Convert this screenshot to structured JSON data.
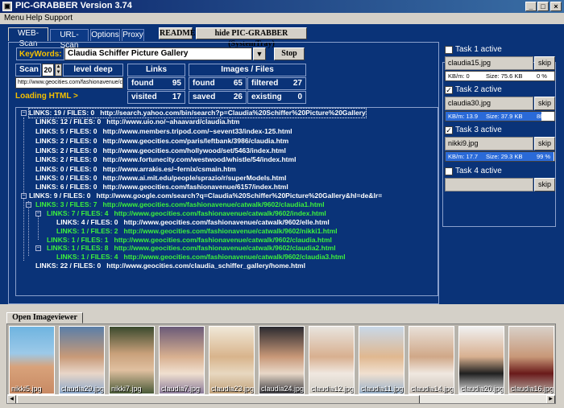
{
  "window": {
    "title": "PIC-GRABBER  Version 3.74"
  },
  "menu": [
    "Menu",
    "Help",
    "Support"
  ],
  "tabs": [
    "WEB-Scan",
    "URL-Scan",
    "Options",
    "Proxy"
  ],
  "buttons": {
    "readme": "README",
    "hide": "hide PIC-GRABBER (SystemTray)",
    "stop": "Stop"
  },
  "search": {
    "label": "KeyWords:",
    "value": "Claudia Schiffer Picture Gallery"
  },
  "scan": {
    "label": "Scan",
    "depth": "20",
    "deep_label": "level deep",
    "url": "http://www.geocities.com/fashionavenue/cat",
    "status": "Loading HTML >"
  },
  "stats": {
    "links_header": "Links",
    "images_header": "Images / Files",
    "found_label": "found",
    "found_value": "95",
    "visited_label": "visited",
    "visited_value": "17",
    "img_found_label": "found",
    "img_found_value": "65",
    "filtered_label": "filtered",
    "filtered_value": "27",
    "saved_label": "saved",
    "saved_value": "26",
    "existing_label": "existing",
    "existing_value": "0"
  },
  "tree": [
    {
      "count": "LINKS: 19 / FILES: 0",
      "url": "http://search.yahoo.com/bin/search?p=Claudia%20Schiffer%20Picture%20Gallery"
    },
    {
      "count": "LINKS: 12 / FILES: 0",
      "url": "http://www.uio.no/~ahaavard/claudia.htm"
    },
    {
      "count": "LINKS: 5 / FILES: 0",
      "url": "http://www.members.tripod.com/~sevent33/index-125.html"
    },
    {
      "count": "LINKS: 2 / FILES: 0",
      "url": "http://www.geocities.com/paris/leftbank/3986/claudia.htm"
    },
    {
      "count": "LINKS: 2 / FILES: 0",
      "url": "http://www.geocities.com/hollywood/set/5463/index.html"
    },
    {
      "count": "LINKS: 2 / FILES: 0",
      "url": "http://www.fortunecity.com/westwood/whistle/54/index.html"
    },
    {
      "count": "LINKS: 0 / FILES: 0",
      "url": "http://www.arrakis.es/~fernix/csmain.htm"
    },
    {
      "count": "LINKS: 0 / FILES: 0",
      "url": "http://www.ai.mit.edu/people/sprazio/r/superModels.html"
    },
    {
      "count": "LINKS: 6 / FILES: 0",
      "url": "http://www.geocities.com/fashionavenue/6157/index.html"
    },
    {
      "count": "LINKS: 9 / FILES: 0",
      "url": "http://www.google.com/search?q=Claudia%20Schiffer%20Picture%20Gallery&hl=de&lr="
    },
    {
      "count": "LINKS: 3 / FILES: 7",
      "url": "http://www.geocities.com/fashionavenue/catwalk/9602/claudia1.html"
    },
    {
      "count": "LINKS: 7 / FILES: 4",
      "url": "http://www.geocities.com/fashionavenue/catwalk/9602/index.html"
    },
    {
      "count": "LINKS: 4 / FILES: 0",
      "url": "http://www.geocities.com/fashionavenue/catwalk/9602/elle.html"
    },
    {
      "count": "LINKS: 1 / FILES: 2",
      "url": "http://www.geocities.com/fashionavenue/catwalk/9602/nikki1.html"
    },
    {
      "count": "LINKS: 1 / FILES: 1",
      "url": "http://www.geocities.com/fashionavenue/catwalk/9602/claudia.html"
    },
    {
      "count": "LINKS: 1 / FILES: 8",
      "url": "http://www.geocities.com/fashionavenue/catwalk/9602/claudia2.html"
    },
    {
      "count": "LINKS: 1 / FILES: 4",
      "url": "http://www.geocities.com/fashionavenue/catwalk/9602/claudia3.html"
    },
    {
      "count": "LINKS: 22 / FILES: 0",
      "url": "http://www.geocities.com/claudia_schiffer_gallery/home.html"
    }
  ],
  "tasks": [
    {
      "label": "Task 1 active",
      "checked": "",
      "file": "claudia15.jpg",
      "skip": "skip",
      "kbs": "KB/m: 0",
      "size": "Size: 75.6 KB",
      "pct": "0 %",
      "progress": 0
    },
    {
      "label": "Task 2 active",
      "checked": "✓",
      "file": "claudia30.jpg",
      "skip": "skip",
      "kbs": "KB/m: 13.9",
      "size": "Size: 37.9 KB",
      "pct": "88 %",
      "progress": 0.88
    },
    {
      "label": "Task 3 active",
      "checked": "✓",
      "file": "nikki9.jpg",
      "skip": "skip",
      "kbs": "KB/m: 17.7",
      "size": "Size: 29.3 KB",
      "pct": "99 %",
      "progress": 0.99
    },
    {
      "label": "Task 4 active",
      "checked": "",
      "file": "",
      "skip": "skip"
    }
  ],
  "viewer": {
    "tab_label": "Open Imageviewer",
    "thumbs": [
      "nikki5.jpg",
      "claudia29.jpg",
      "nikki7.jpg",
      "claudia7.jpg",
      "claudia23.jpg",
      "claudia24.jpg",
      "claudia12.jpg",
      "claudia11.jpg",
      "claudia14.jpg",
      "claudia20.jpg",
      "claudia16.jpg"
    ]
  },
  "colors": {
    "panel_bg": "#0a3378",
    "link_green": "#3cf03c",
    "status_yellow": "#f5c000"
  }
}
